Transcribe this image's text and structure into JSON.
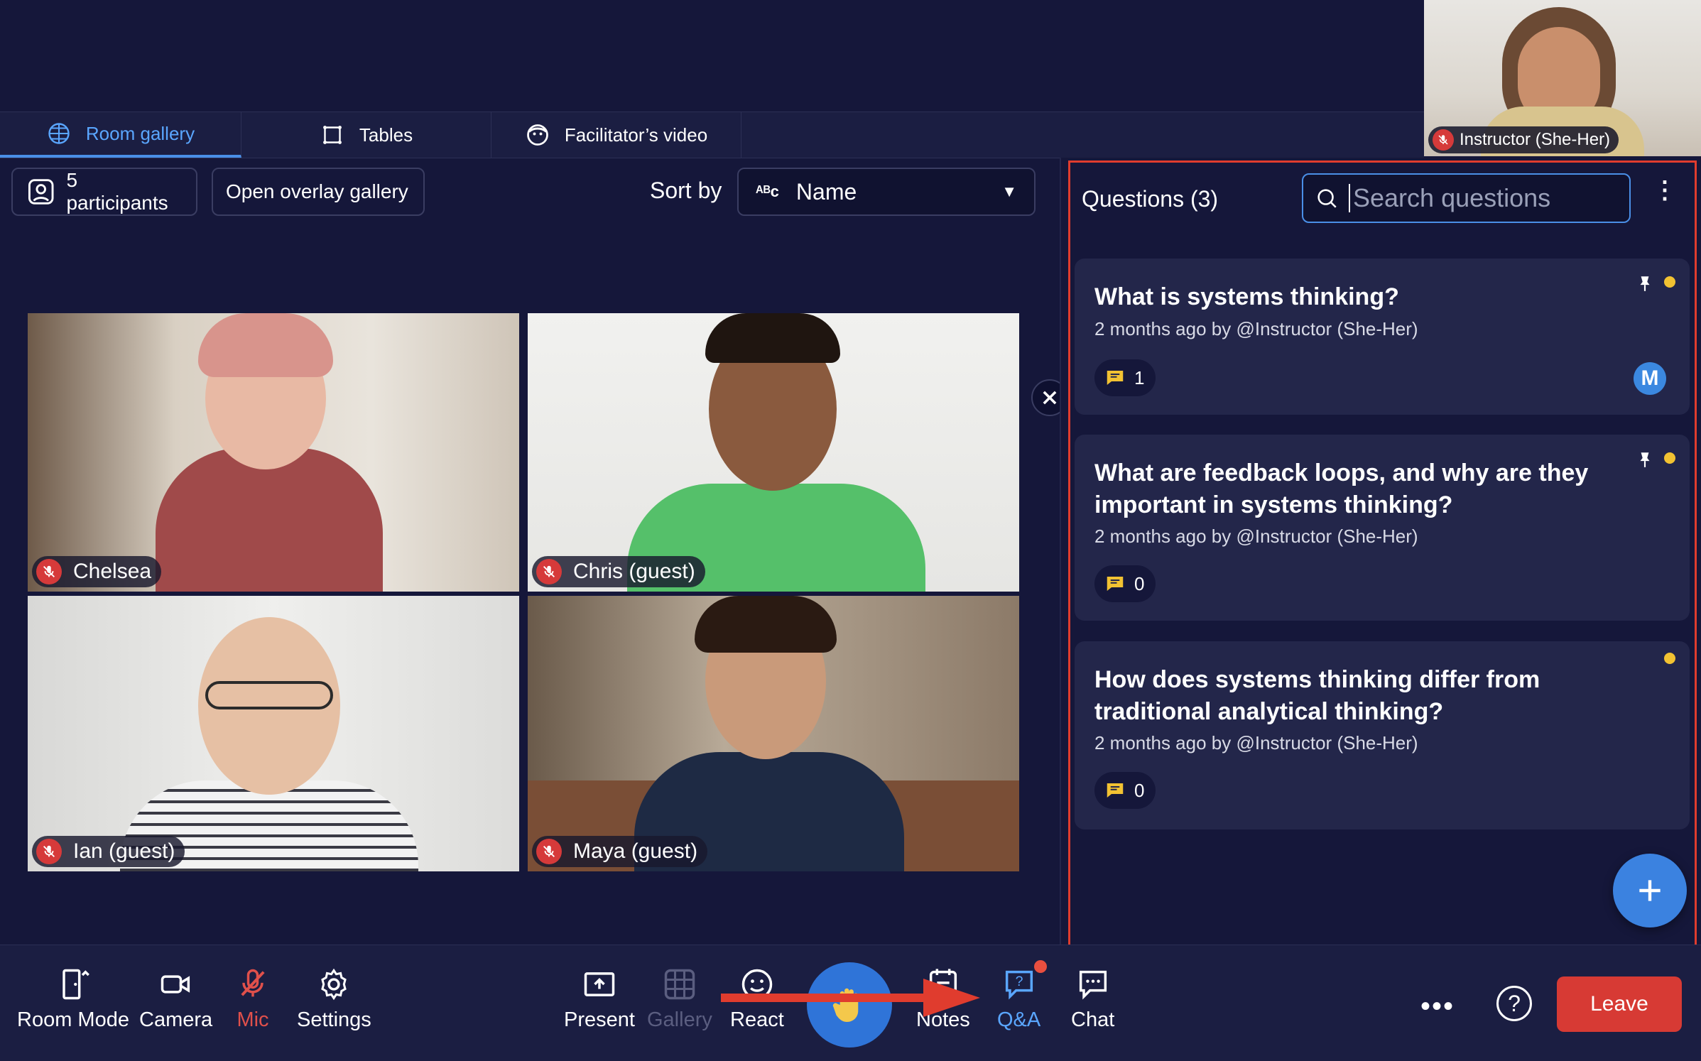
{
  "tabs": [
    {
      "label": "Room gallery",
      "icon": "grid-globe-icon",
      "active": true
    },
    {
      "label": "Tables",
      "icon": "tables-icon",
      "active": false
    },
    {
      "label": "Facilitator’s video",
      "icon": "face-icon",
      "active": false
    }
  ],
  "self_view": {
    "name": "Instructor (She-Her)",
    "muted": true
  },
  "toolbar": {
    "participants_label": "5 participants",
    "overlay_label": "Open overlay gallery",
    "sort_label": "Sort by",
    "sort_value": "Name"
  },
  "participants": [
    {
      "name": "Chelsea",
      "muted": true
    },
    {
      "name": "Chris (guest)",
      "muted": true
    },
    {
      "name": "Ian (guest)",
      "muted": true
    },
    {
      "name": "Maya (guest)",
      "muted": true
    }
  ],
  "qa": {
    "title": "Questions (3)",
    "search_placeholder": "Search questions",
    "questions": [
      {
        "text": "What is systems thinking?",
        "meta": "2 months ago by @Instructor (She-Her)",
        "replies": "1",
        "pinned": true,
        "avatar": "M"
      },
      {
        "text": "What are feedback loops, and why are they important in systems thinking?",
        "meta": "2 months ago by @Instructor (She-Her)",
        "replies": "0",
        "pinned": true
      },
      {
        "text": "How does systems thinking differ from traditional analytical thinking?",
        "meta": "2 months ago by @Instructor (She-Her)",
        "replies": "0",
        "pinned": false
      }
    ]
  },
  "bottom_bar": {
    "room_mode": "Room Mode",
    "camera": "Camera",
    "mic": "Mic",
    "settings": "Settings",
    "present": "Present",
    "gallery": "Gallery",
    "react": "React",
    "notes": "Notes",
    "qa": "Q&A",
    "chat": "Chat",
    "leave": "Leave",
    "help": "?"
  },
  "colors": {
    "background": "#15173a",
    "accent": "#4a8fe7",
    "danger": "#d73a34",
    "annotation": "#e03c2e",
    "unread_dot": "#f2c232"
  }
}
